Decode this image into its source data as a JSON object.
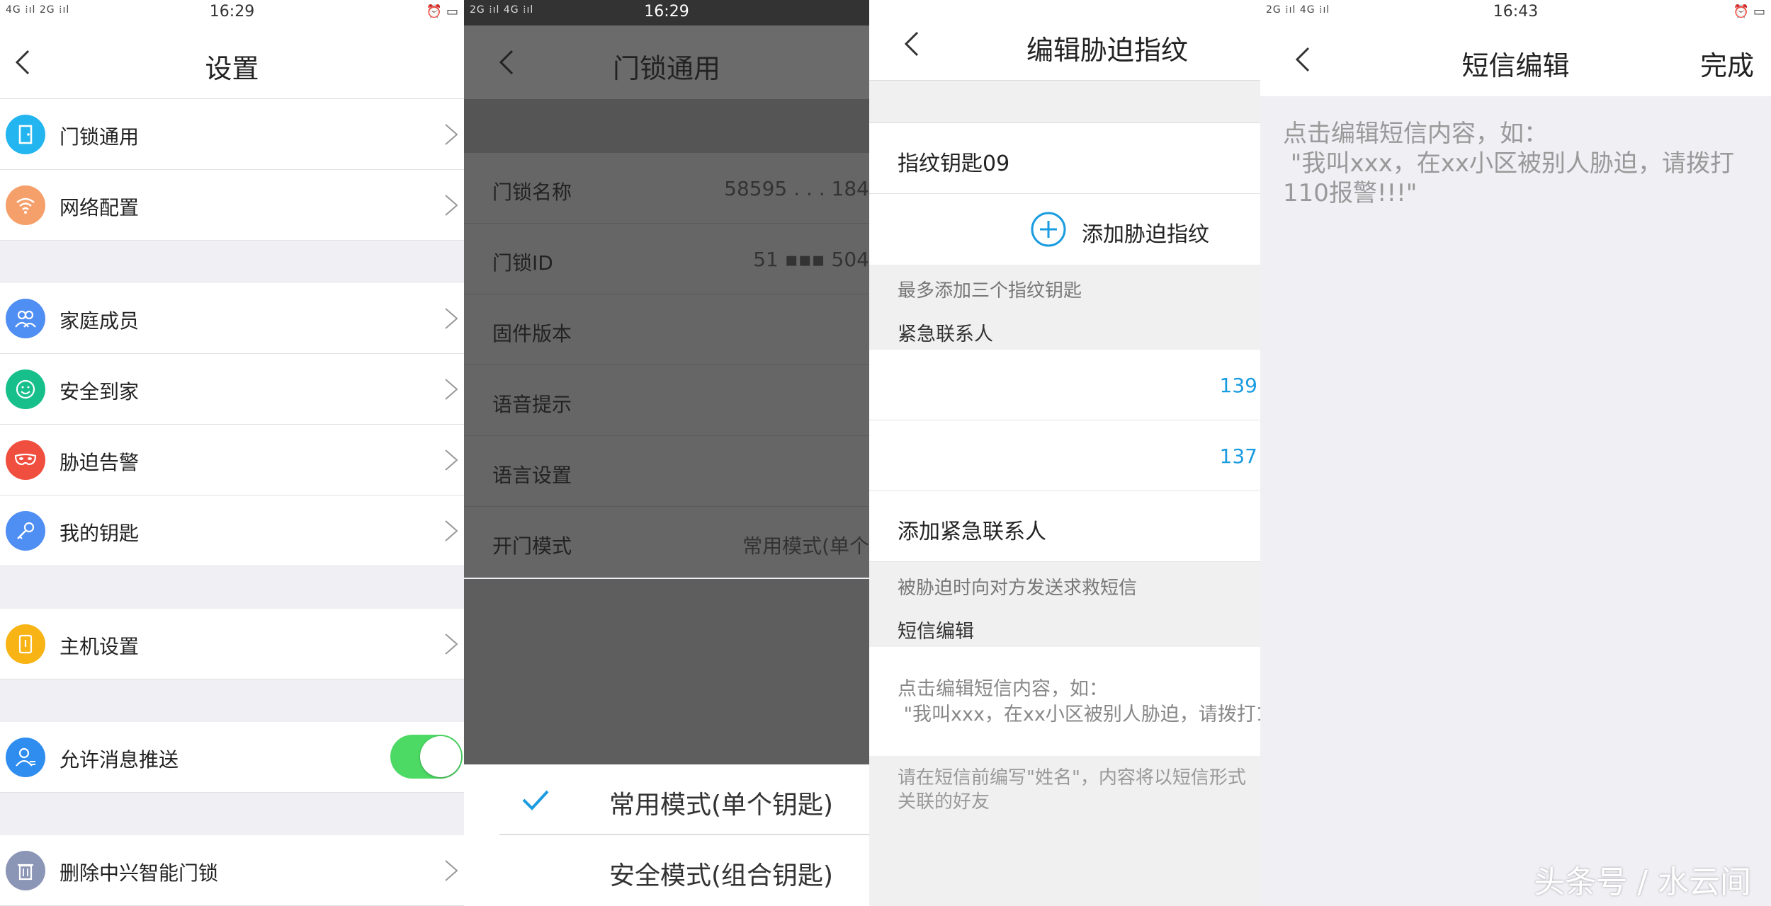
{
  "panel1": {
    "status": {
      "left": "4G ⁞ıl 2G ⁞ıl",
      "time": "16:29",
      "right": "⏰ ▭"
    },
    "title": "设置",
    "groups": [
      [
        {
          "label": "门锁通用",
          "icon": "door-icon",
          "color": "#23b5f0"
        },
        {
          "label": "网络配置",
          "icon": "wifi-icon",
          "color": "#f5a06b"
        }
      ],
      [
        {
          "label": "家庭成员",
          "icon": "family-icon",
          "color": "#4f8ef2"
        },
        {
          "label": "安全到家",
          "icon": "smile-icon",
          "color": "#17c08a"
        },
        {
          "label": "胁迫告警",
          "icon": "mask-icon",
          "color": "#f04e3e"
        },
        {
          "label": "我的钥匙",
          "icon": "key-icon",
          "color": "#4f8ef2"
        }
      ],
      [
        {
          "label": "主机设置",
          "icon": "host-icon",
          "color": "#f8b315"
        }
      ],
      [
        {
          "label": "允许消息推送",
          "icon": "user-icon",
          "color": "#2f8df0",
          "toggle": true
        }
      ],
      [
        {
          "label": "删除中兴智能门锁",
          "icon": "trash-icon",
          "color": "#8b95b5"
        }
      ]
    ]
  },
  "panel2": {
    "status": {
      "left": "2G ⁞ıl 4G ⁞ıl",
      "time": "16:29"
    },
    "title": "门锁通用",
    "rows": [
      {
        "label": "门锁名称",
        "value": "58595 . . . 184"
      },
      {
        "label": "门锁ID",
        "value": "51 ▪▪▪ 504"
      },
      {
        "label": "固件版本",
        "value": ""
      },
      {
        "label": "语音提示",
        "value": ""
      },
      {
        "label": "语言设置",
        "value": ""
      },
      {
        "label": "开门模式",
        "value": "常用模式(单个"
      }
    ],
    "sheet": {
      "option1": "常用模式(单个钥匙)",
      "option2": "安全模式(组合钥匙)"
    }
  },
  "panel3": {
    "title": "编辑胁迫指纹",
    "key_name": "指纹钥匙09",
    "add_fingerprint": "添加胁迫指纹",
    "max_hint": "最多添加三个指纹钥匙",
    "contacts_header": "紧急联系人",
    "contacts": [
      "139",
      "137"
    ],
    "add_contact": "添加紧急联系人",
    "contact_hint": "被胁迫时向对方发送求救短信",
    "sms_header": "短信编辑",
    "sms_placeholder": "点击编辑短信内容，如：\n \"我叫xxx，在xx小区被别人胁迫，请拨打1",
    "sms_note": "请在短信前编写\"姓名\"，内容将以短信形式\n关联的好友"
  },
  "panel4": {
    "status": {
      "left": "2G ⁞ıl 4G ⁞ıl",
      "time": "16:43",
      "right": "⏰ ▭"
    },
    "title": "短信编辑",
    "done": "完成",
    "content": "点击编辑短信内容，如：\n \"我叫xxx，在xx小区被别人胁迫，请拨打\n110报警!!!\"",
    "watermark": "头条号 / 水云间"
  }
}
